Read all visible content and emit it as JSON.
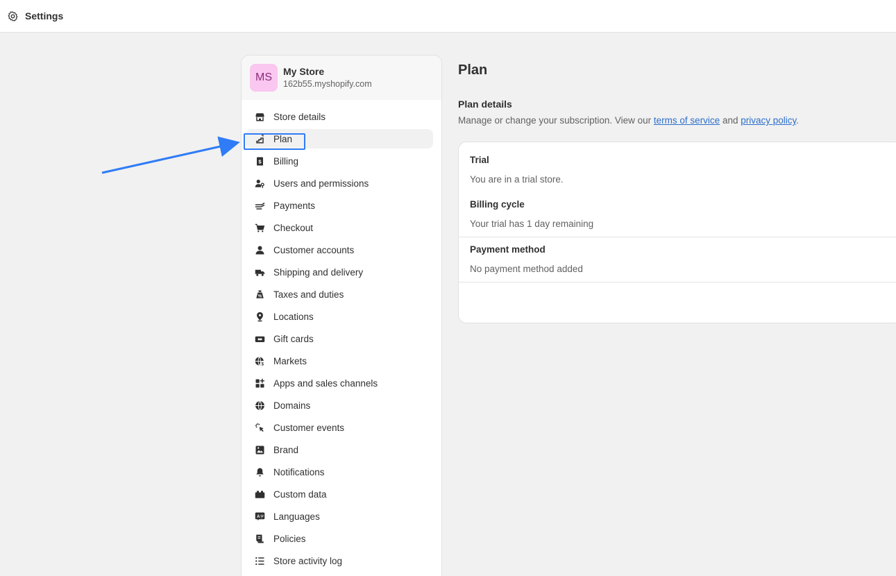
{
  "header": {
    "title": "Settings",
    "icon": "gear-icon"
  },
  "store": {
    "avatar_initials": "MS",
    "name": "My Store",
    "domain": "162b55.myshopify.com"
  },
  "nav": {
    "items": [
      {
        "label": "Store details",
        "icon": "store-icon"
      },
      {
        "label": "Plan",
        "icon": "plan-icon",
        "active": true
      },
      {
        "label": "Billing",
        "icon": "billing-icon"
      },
      {
        "label": "Users and permissions",
        "icon": "users-icon"
      },
      {
        "label": "Payments",
        "icon": "payments-icon"
      },
      {
        "label": "Checkout",
        "icon": "cart-icon"
      },
      {
        "label": "Customer accounts",
        "icon": "person-icon"
      },
      {
        "label": "Shipping and delivery",
        "icon": "truck-icon"
      },
      {
        "label": "Taxes and duties",
        "icon": "tax-icon"
      },
      {
        "label": "Locations",
        "icon": "location-icon"
      },
      {
        "label": "Gift cards",
        "icon": "gift-card-icon"
      },
      {
        "label": "Markets",
        "icon": "globe-dollar-icon"
      },
      {
        "label": "Apps and sales channels",
        "icon": "apps-icon"
      },
      {
        "label": "Domains",
        "icon": "globe-icon"
      },
      {
        "label": "Customer events",
        "icon": "cursor-click-icon"
      },
      {
        "label": "Brand",
        "icon": "brand-icon"
      },
      {
        "label": "Notifications",
        "icon": "bell-icon"
      },
      {
        "label": "Custom data",
        "icon": "database-icon"
      },
      {
        "label": "Languages",
        "icon": "language-icon"
      },
      {
        "label": "Policies",
        "icon": "policy-icon"
      },
      {
        "label": "Store activity log",
        "icon": "list-icon"
      }
    ]
  },
  "main": {
    "title": "Plan",
    "section_title": "Plan details",
    "desc_prefix": "Manage or change your subscription. View our ",
    "terms_link": "terms of service",
    "desc_and": " and ",
    "privacy_link": "privacy policy",
    "desc_suffix": ".",
    "card": {
      "trial_label": "Trial",
      "trial_value": "You are in a trial store.",
      "billing_label": "Billing cycle",
      "billing_value": "Your trial has 1 day remaining",
      "payment_label": "Payment method",
      "payment_value": "No payment method added"
    }
  },
  "colors": {
    "annotation": "#2f7cf6",
    "link": "#2c6ecb",
    "avatar_bg": "#f9c7f0"
  }
}
